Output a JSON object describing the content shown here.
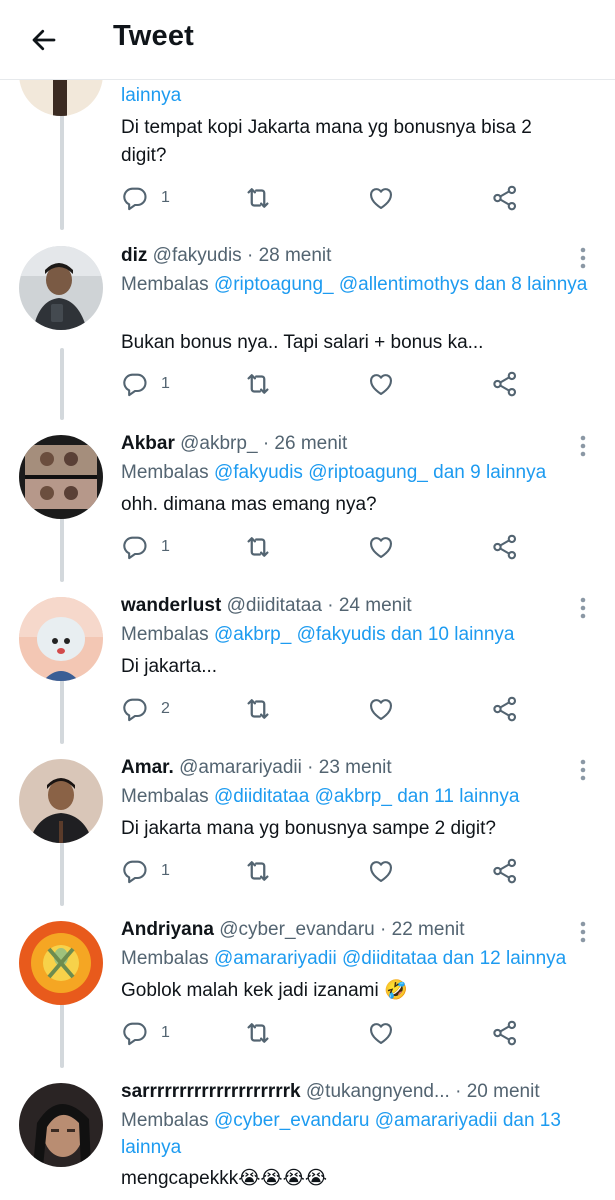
{
  "header": {
    "title": "Tweet"
  },
  "top_partial": {
    "reply_tail": "lainnya",
    "text": "Di tempat kopi Jakarta mana yg bonusnya bisa 2 digit?",
    "text_lines": [
      "Di tempat kopi Jakarta mana yg bonusnya bisa 2",
      "digit?"
    ],
    "reply_count": "1"
  },
  "reply_prefix": "Membalas",
  "tweets": [
    {
      "name": "diz",
      "handle": "@fakyudis",
      "dot": "·",
      "time": "28 menit",
      "mentions": [
        "@riptoagung_",
        "@allentimothys"
      ],
      "and_text": "dan 8 lainnya",
      "text": "Bukan bonus nya.. Tapi salari + bonus ka...",
      "reply_count": "1"
    },
    {
      "name": "Akbar",
      "handle": "@akbrp_",
      "dot": "·",
      "time": "26 menit",
      "mentions": [
        "@fakyudis",
        "@riptoagung_"
      ],
      "and_text": "dan 9 lainnya",
      "text": "ohh. dimana mas emang nya?",
      "reply_count": "1"
    },
    {
      "name": "wanderlust",
      "handle": "@diiditataa",
      "dot": "·",
      "time": "24 menit",
      "mentions": [
        "@akbrp_",
        "@fakyudis"
      ],
      "and_text": "dan 10 lainnya",
      "text": "Di jakarta...",
      "reply_count": "2"
    },
    {
      "name": "Amar.",
      "handle": "@amarariyadii",
      "dot": "·",
      "time": "23 menit",
      "mentions": [
        "@diiditataa",
        "@akbrp_"
      ],
      "and_text": "dan 11 lainnya",
      "text": "Di jakarta mana yg bonusnya sampe 2 digit?",
      "reply_count": "1"
    },
    {
      "name": "Andriyana",
      "handle": "@cyber_evandaru",
      "dot": "·",
      "time": "22 menit",
      "mentions": [
        "@amarariyadii",
        "@diiditataa"
      ],
      "and_text": "dan 12 lainnya",
      "text": "Goblok malah kek jadi izanami 🤣",
      "reply_count": "1"
    },
    {
      "name": "sarrrrrrrrrrrrrrrrrrrrk",
      "handle": "@tukangnyend...",
      "dot": "·",
      "time": "20 menit",
      "mentions": [
        "@cyber_evandaru",
        "@amarariyadii"
      ],
      "and_text": "dan 13 lainnya",
      "text": "mengcapekkk😭😭😭😭",
      "reply_count": ""
    }
  ],
  "icons": {
    "back": "arrow-left-icon",
    "more": "more-vertical-icon",
    "reply": "reply-icon",
    "retweet": "retweet-icon",
    "like": "heart-icon",
    "share": "share-icon"
  },
  "colors": {
    "link": "#1d9bf0",
    "secondary": "#536471",
    "text": "#0f1419",
    "thread": "#d3d8dc"
  }
}
